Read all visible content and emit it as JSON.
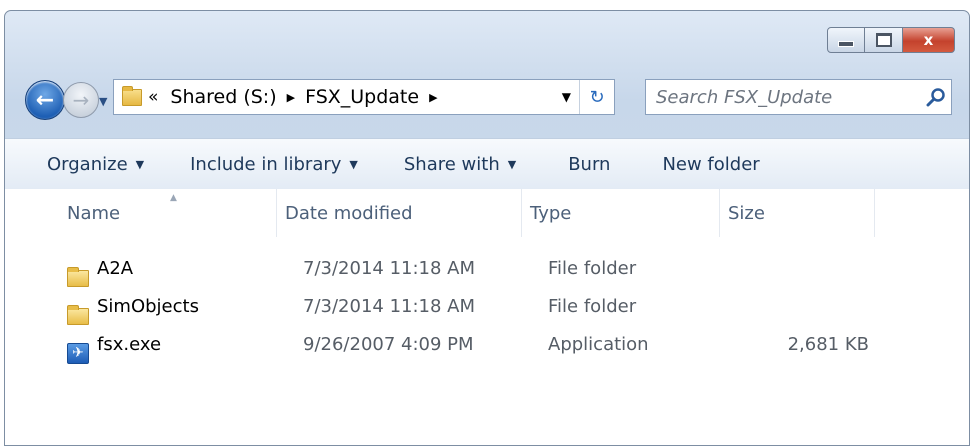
{
  "window": {
    "close_glyph": "x",
    "colors": {
      "close_button": "#c4422d",
      "accent": "#1e5fb4"
    }
  },
  "nav": {
    "back_glyph": "←",
    "forward_glyph": "→",
    "recent_glyph": "▼"
  },
  "address": {
    "overflow_glyph": "«",
    "crumbs": [
      "Shared (S:)",
      "FSX_Update"
    ],
    "separator": "▶",
    "dropdown_glyph": "▼",
    "refresh_glyph": "↻"
  },
  "search": {
    "placeholder": "Search FSX_Update",
    "icon": "search-icon"
  },
  "toolbar": {
    "dropdown_glyph": "▼",
    "organize": "Organize",
    "include_in_library": "Include in library",
    "share_with": "Share with",
    "burn": "Burn",
    "new_folder": "New folder"
  },
  "table": {
    "columns": [
      "Name",
      "Date modified",
      "Type",
      "Size"
    ],
    "sort_glyph": "▲",
    "rows": [
      {
        "icon": "folder-icon",
        "name": "A2A",
        "date": "7/3/2014 11:18 AM",
        "type": "File folder",
        "size": ""
      },
      {
        "icon": "folder-icon",
        "name": "SimObjects",
        "date": "7/3/2014 11:18 AM",
        "type": "File folder",
        "size": ""
      },
      {
        "icon": "application-icon",
        "name": "fsx.exe",
        "date": "9/26/2007 4:09 PM",
        "type": "Application",
        "size": "2,681 KB"
      }
    ]
  }
}
